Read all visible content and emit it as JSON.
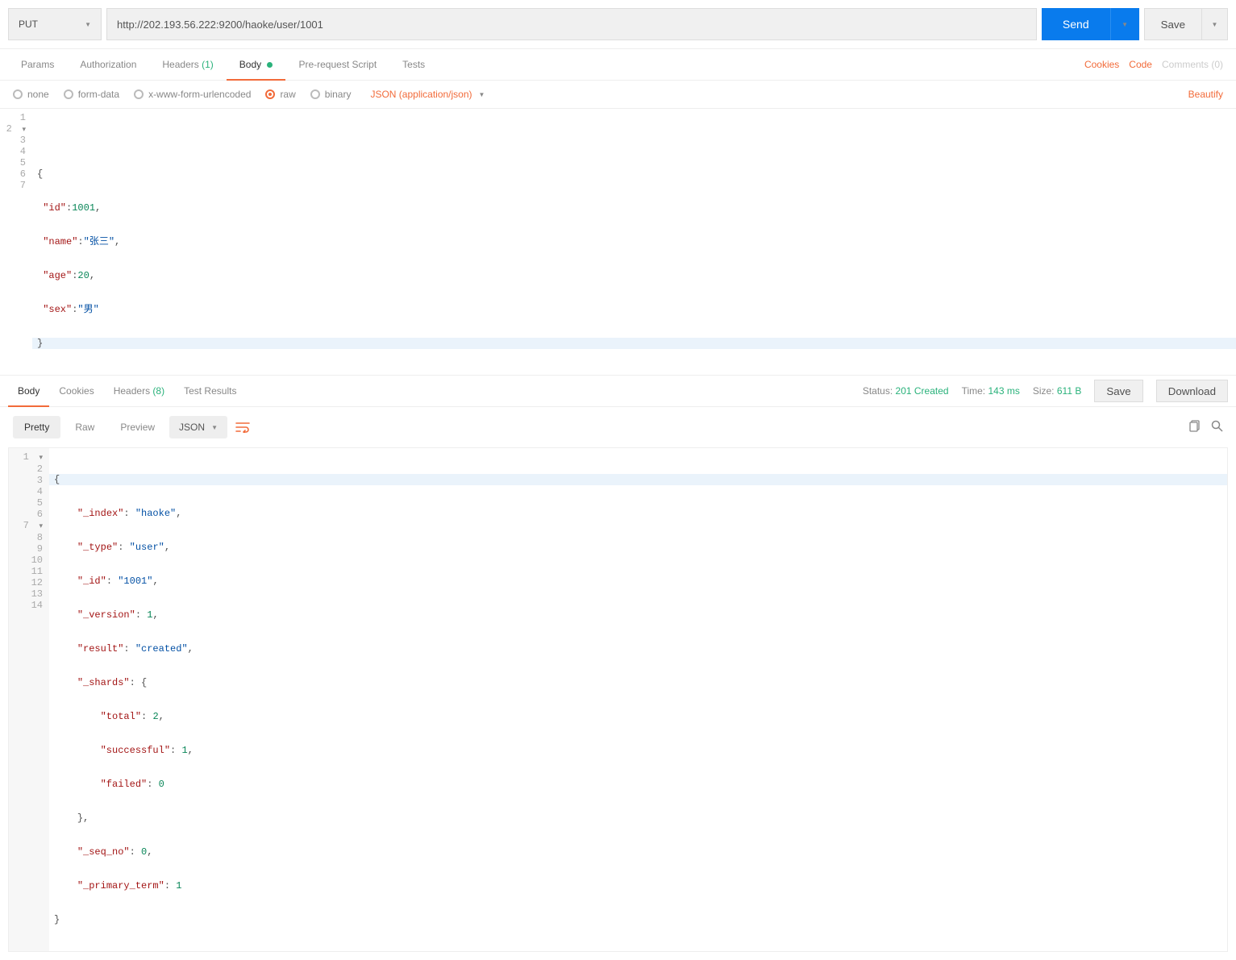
{
  "request": {
    "method": "PUT",
    "url": "http://202.193.56.222:9200/haoke/user/1001"
  },
  "buttons": {
    "send": "Send",
    "save": "Save",
    "download": "Download",
    "saveResp": "Save"
  },
  "tabs": {
    "params": "Params",
    "authorization": "Authorization",
    "headers": "Headers",
    "headersCount": "(1)",
    "body": "Body",
    "prerequest": "Pre-request Script",
    "tests": "Tests"
  },
  "links": {
    "cookies": "Cookies",
    "code": "Code",
    "comments": "Comments (0)",
    "beautify": "Beautify"
  },
  "bodyTypes": {
    "none": "none",
    "formdata": "form-data",
    "xwww": "x-www-form-urlencoded",
    "raw": "raw",
    "binary": "binary",
    "contentType": "JSON (application/json)"
  },
  "reqBody": {
    "lines": [
      "1",
      "2",
      "3",
      "4",
      "5",
      "6",
      "7"
    ],
    "l1": "",
    "l2": "{",
    "l3_k": "\"id\"",
    "l3_v": "1001",
    "l4_k": "\"name\"",
    "l4_v": "\"张三\"",
    "l5_k": "\"age\"",
    "l5_v": "20",
    "l6_k": "\"sex\"",
    "l6_v": "\"男\"",
    "l7": "}"
  },
  "respTabs": {
    "body": "Body",
    "cookies": "Cookies",
    "headers": "Headers",
    "headersCount": "(8)",
    "testResults": "Test Results"
  },
  "respStatus": {
    "statusLabel": "Status:",
    "statusVal": "201 Created",
    "timeLabel": "Time:",
    "timeVal": "143 ms",
    "sizeLabel": "Size:",
    "sizeVal": "611 B"
  },
  "respTools": {
    "pretty": "Pretty",
    "raw": "Raw",
    "preview": "Preview",
    "format": "JSON"
  },
  "respBody": {
    "lines": [
      "1",
      "2",
      "3",
      "4",
      "5",
      "6",
      "7",
      "8",
      "9",
      "10",
      "11",
      "12",
      "13",
      "14"
    ],
    "r1": "{",
    "r2_k": "\"_index\"",
    "r2_v": "\"haoke\"",
    "r3_k": "\"_type\"",
    "r3_v": "\"user\"",
    "r4_k": "\"_id\"",
    "r4_v": "\"1001\"",
    "r5_k": "\"_version\"",
    "r5_v": "1",
    "r6_k": "\"result\"",
    "r6_v": "\"created\"",
    "r7_k": "\"_shards\"",
    "r7_v": "{",
    "r8_k": "\"total\"",
    "r8_v": "2",
    "r9_k": "\"successful\"",
    "r9_v": "1",
    "r10_k": "\"failed\"",
    "r10_v": "0",
    "r11": "},",
    "r12_k": "\"_seq_no\"",
    "r12_v": "0",
    "r13_k": "\"_primary_term\"",
    "r13_v": "1",
    "r14": "}"
  }
}
